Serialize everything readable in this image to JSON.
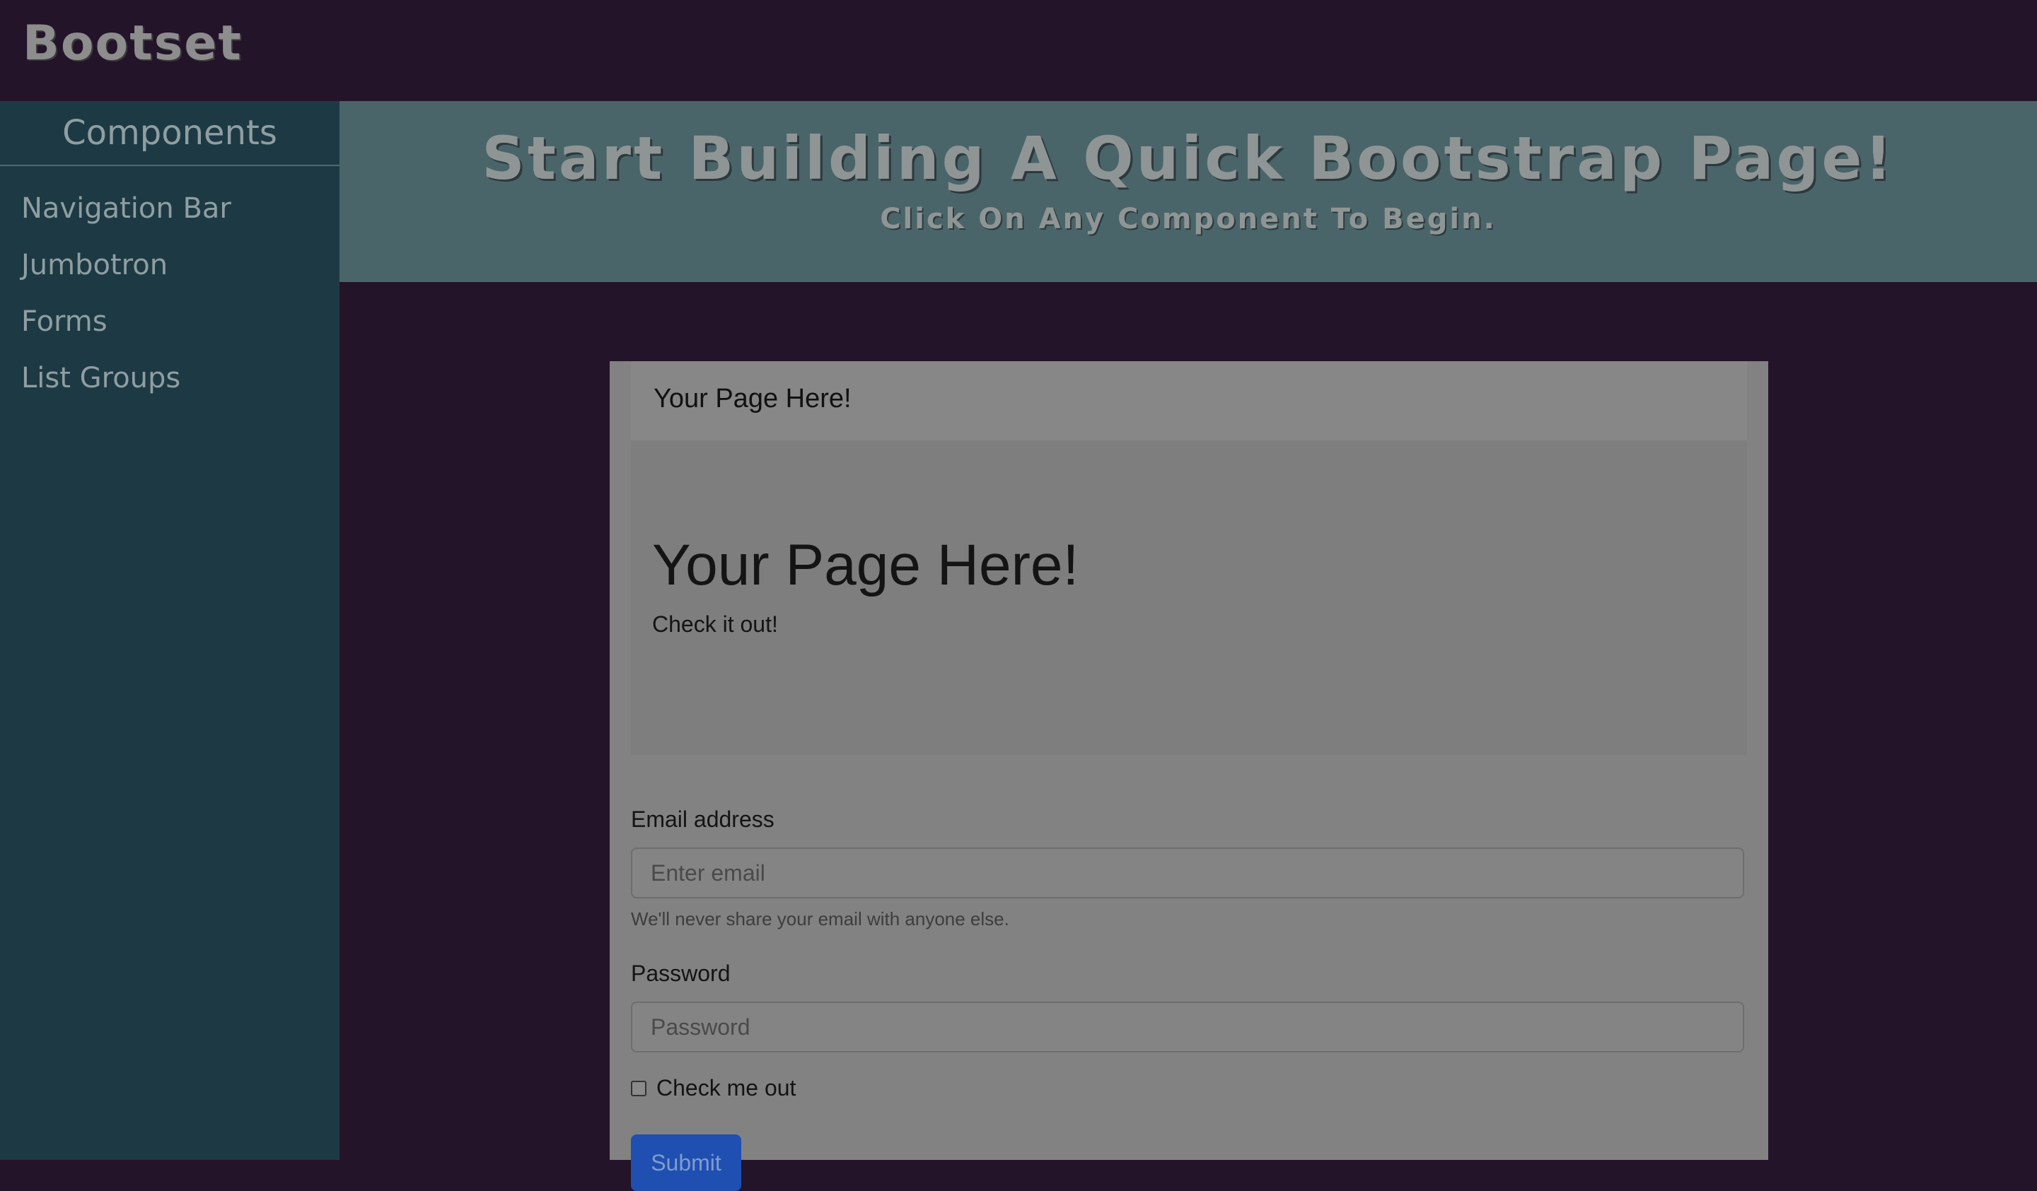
{
  "app": {
    "brand": "Bootset"
  },
  "sidebar": {
    "title": "Components",
    "items": [
      {
        "label": "Navigation Bar"
      },
      {
        "label": "Jumbotron"
      },
      {
        "label": "Forms"
      },
      {
        "label": "List Groups"
      }
    ]
  },
  "hero": {
    "title": "Start Building A Quick Bootstrap Page!",
    "subtitle": "Click On Any Component To Begin."
  },
  "preview": {
    "navbar": {
      "brand": "Your Page Here!"
    },
    "jumbotron": {
      "title": "Your Page Here!",
      "text": "Check it out!"
    },
    "form": {
      "email_label": "Email address",
      "email_placeholder": "Enter email",
      "email_help": "We'll never share your email with anyone else.",
      "password_label": "Password",
      "password_placeholder": "Password",
      "checkbox_label": "Check me out",
      "submit_label": "Submit"
    }
  },
  "colors": {
    "page_bg": "#23142a",
    "sidebar_bg": "#1d3a44",
    "hero_bg": "#4a6569",
    "submit_bg": "#1f4fb0"
  }
}
